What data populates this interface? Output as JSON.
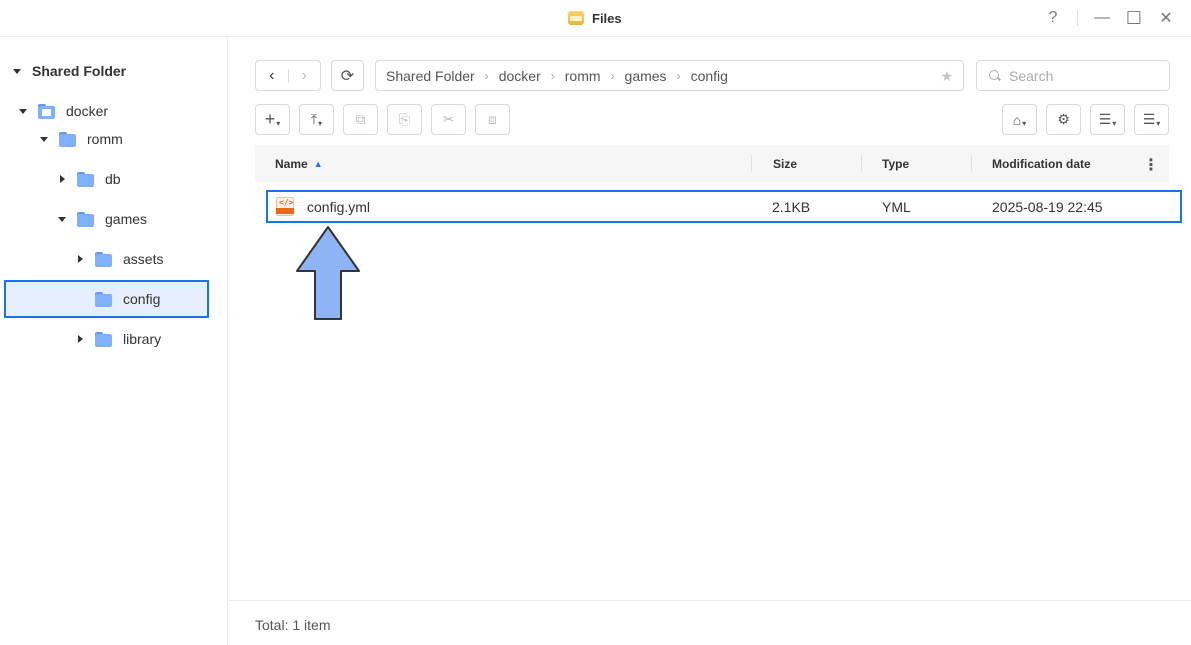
{
  "window": {
    "title": "Files",
    "help_icon": "?",
    "minimize_icon": "—",
    "maximize_icon": "☐",
    "close_icon": "✕"
  },
  "sidebar": {
    "root": "Shared Folder",
    "items": [
      {
        "label": "docker",
        "icon": "shared-folder-icon",
        "expanded": true
      },
      {
        "label": "romm",
        "icon": "folder-icon",
        "expanded": true
      },
      {
        "label": "db",
        "icon": "folder-icon",
        "expanded": false
      },
      {
        "label": "games",
        "icon": "folder-icon",
        "expanded": true
      },
      {
        "label": "assets",
        "icon": "folder-icon",
        "expanded": false
      },
      {
        "label": "config",
        "icon": "folder-icon",
        "selected": true
      },
      {
        "label": "library",
        "icon": "folder-icon",
        "expanded": false
      }
    ]
  },
  "toolbar": {
    "back_icon": "‹",
    "forward_icon": "›",
    "refresh_icon": "⟳",
    "breadcrumb": [
      "Shared Folder",
      "docker",
      "romm",
      "games",
      "config"
    ],
    "favorite_icon": "★",
    "search_placeholder": "Search",
    "create_icon": "+",
    "upload_icon": "⤒",
    "copy_icon": "⧉",
    "paste_icon": "⎘",
    "cut_icon": "✂",
    "duplicate_icon": "⧈",
    "action_icon": "⌂",
    "settings_icon": "⚙",
    "view_icon": "☰",
    "sort_icon": "☰"
  },
  "table": {
    "columns": [
      "Name",
      "Size",
      "Type",
      "Modification date"
    ],
    "sort_indicator": "▲",
    "rows": [
      {
        "name": "config.yml",
        "size": "2.1KB",
        "type": "YML",
        "modified": "2025-08-19 22:45"
      }
    ]
  },
  "annotation": {
    "color": "#8fb4f5",
    "stroke": "#333333"
  },
  "footer": {
    "total": "Total: 1 item"
  },
  "colors": {
    "accent": "#1a73e8",
    "folder": "#7fb0fb",
    "yml": "#e8691d"
  }
}
